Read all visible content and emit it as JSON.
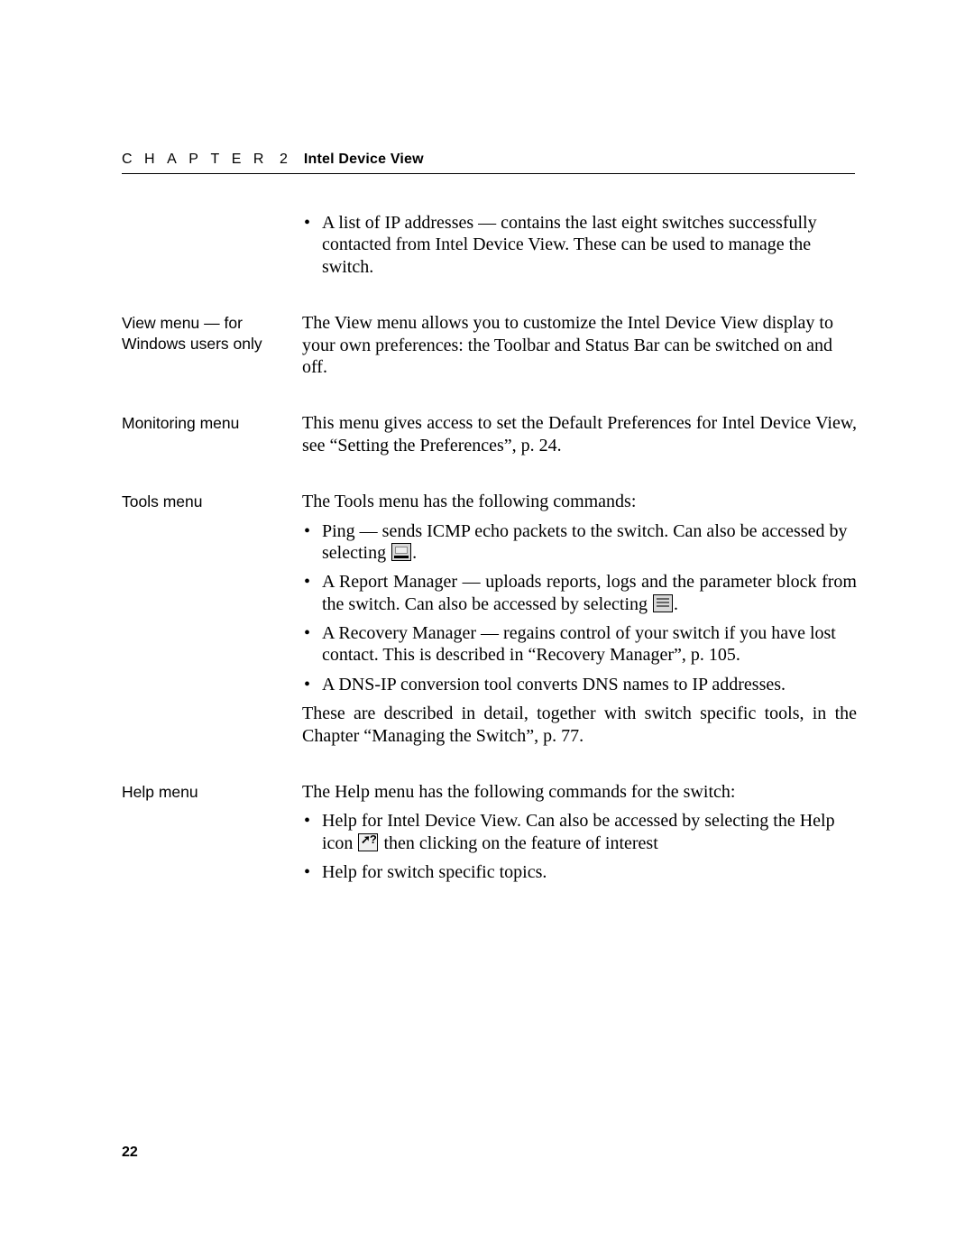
{
  "header": {
    "chapter_word": "CHAPTER",
    "chapter_number": "2",
    "title": "Intel Device View"
  },
  "sections": {
    "intro_bullet": "A list of IP addresses — contains the last eight switches successfully contacted from Intel Device View. These can be used to manage the switch.",
    "view_menu": {
      "label": "View menu — for Windows users only",
      "text": "The View menu allows you to customize the Intel Device View display to your own preferences: the Toolbar and Status Bar can be switched on and off."
    },
    "monitoring_menu": {
      "label": "Monitoring menu",
      "text": "This menu gives access to set the Default Preferences for Intel Device View, see “Setting the Preferences”, p. 24."
    },
    "tools_menu": {
      "label": "Tools menu",
      "intro": "The Tools menu has the following commands:",
      "items": {
        "ping_a": "Ping — sends ICMP echo packets to the switch. Can also be accessed by selecting ",
        "ping_b": ".",
        "report_a": "A Report Manager — uploads reports, logs and the parameter block from the switch. Can also be accessed by selecting ",
        "report_b": ".",
        "recovery": "A Recovery Manager — regains control of your switch if you have lost contact. This is described in “Recovery Manager”, p. 105.",
        "dns": "A DNS-IP conversion tool converts DNS names to IP addresses."
      },
      "outro": "These are described in detail, together with switch specific tools, in the Chapter  “Managing the Switch”, p. 77."
    },
    "help_menu": {
      "label": "Help menu",
      "intro": "The Help menu has the following commands for the switch:",
      "items": {
        "help_a": "Help for Intel Device View. Can also be accessed by selecting the Help icon ",
        "help_b": " then clicking on the feature of interest",
        "topics": "Help for switch specific topics."
      }
    }
  },
  "page_number": "22"
}
